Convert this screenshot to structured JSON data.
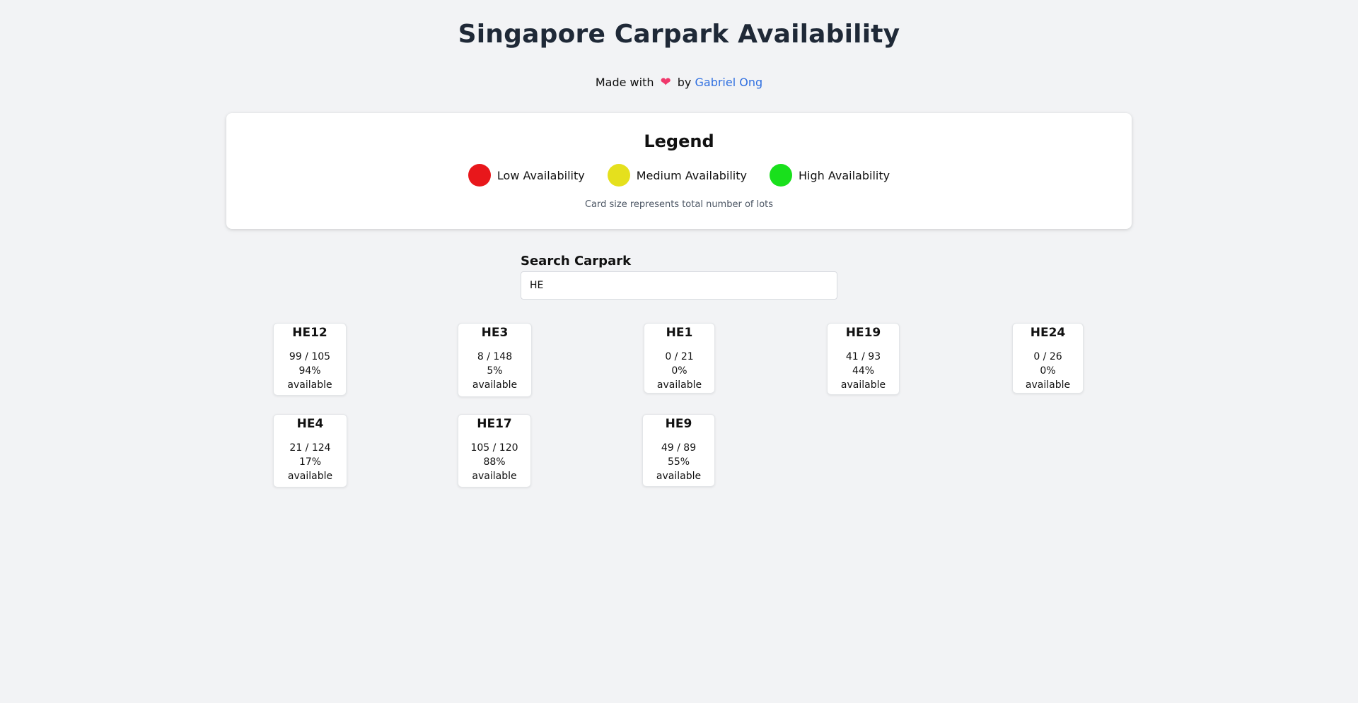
{
  "header": {
    "title": "Singapore Carpark Availability",
    "credit_prefix": "Made with",
    "credit_by": "by",
    "author": "Gabriel Ong",
    "heart_icon": "heart-icon"
  },
  "legend": {
    "title": "Legend",
    "items": [
      {
        "label": "Low Availability",
        "color": "#e8171b"
      },
      {
        "label": "Medium Availability",
        "color": "#e5e01d"
      },
      {
        "label": "High Availability",
        "color": "#19e01c"
      }
    ],
    "note": "Card size represents total number of lots"
  },
  "search": {
    "label": "Search Carpark",
    "value": "HE"
  },
  "carparks": [
    {
      "name": "HE12",
      "count": "99 / 105",
      "percent": "94%",
      "status": "available"
    },
    {
      "name": "HE3",
      "count": "8 / 148",
      "percent": "5%",
      "status": "available"
    },
    {
      "name": "HE1",
      "count": "0 / 21",
      "percent": "0%",
      "status": "available"
    },
    {
      "name": "HE19",
      "count": "41 / 93",
      "percent": "44%",
      "status": "available"
    },
    {
      "name": "HE24",
      "count": "0 / 26",
      "percent": "0%",
      "status": "available"
    },
    {
      "name": "HE4",
      "count": "21 / 124",
      "percent": "17%",
      "status": "available"
    },
    {
      "name": "HE17",
      "count": "105 / 120",
      "percent": "88%",
      "status": "available"
    },
    {
      "name": "HE9",
      "count": "49 / 89",
      "percent": "55%",
      "status": "available"
    }
  ]
}
